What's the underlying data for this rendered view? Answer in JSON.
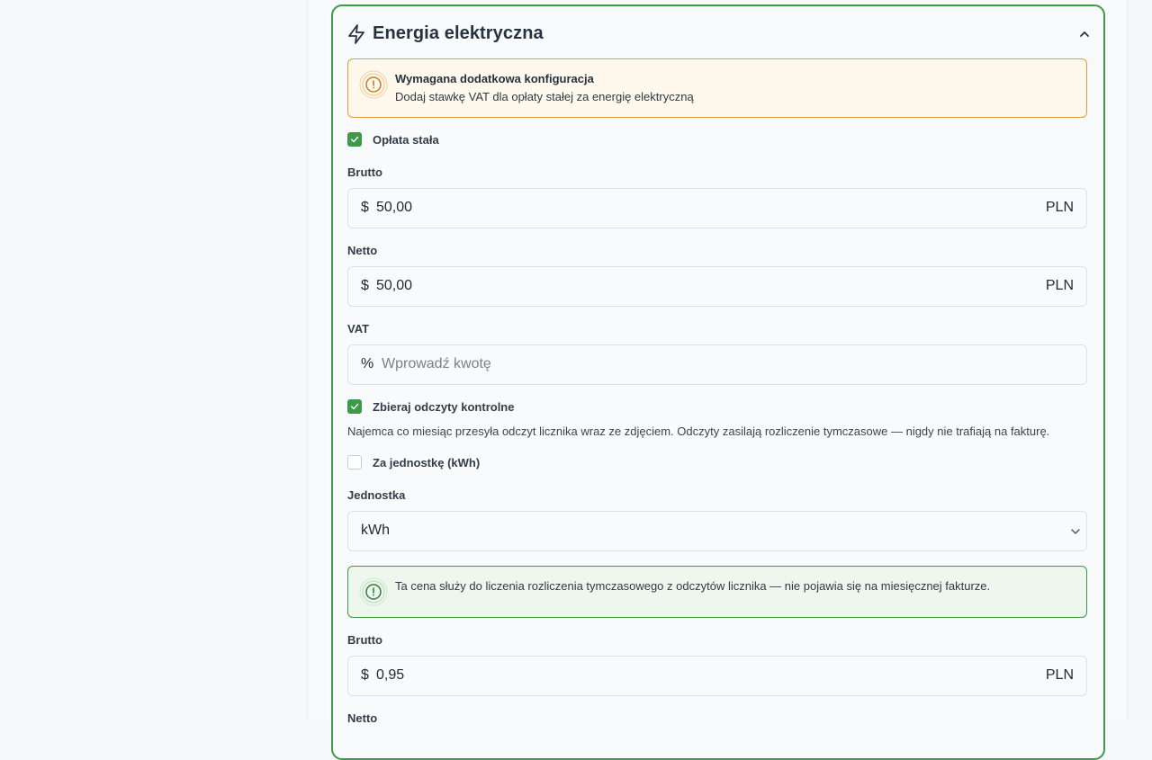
{
  "section": {
    "title": "Energia elektryczna",
    "icon": "bolt-icon",
    "collapse_icon": "chevron-up-icon"
  },
  "warning": {
    "title": "Wymagana dodatkowa konfiguracja",
    "text": "Dodaj stawkę VAT dla opłaty stałej za energię elektryczną",
    "icon": "alert-circle-icon"
  },
  "fixed_fee": {
    "checkbox_label": "Opłata stała",
    "checked": true,
    "gross": {
      "label": "Brutto",
      "prefix": "$",
      "value": "50,00",
      "suffix": "PLN"
    },
    "net": {
      "label": "Netto",
      "prefix": "$",
      "value": "50,00",
      "suffix": "PLN"
    },
    "vat": {
      "label": "VAT",
      "prefix": "%",
      "placeholder": "Wprowadź kwotę"
    }
  },
  "readings": {
    "checkbox_label": "Zbieraj odczyty kontrolne",
    "checked": true,
    "help": "Najemca co miesiąc przesyła odczyt licznika wraz ze zdjęciem. Odczyty zasilają rozliczenie tymczasowe — nigdy nie trafiają na fakturę."
  },
  "per_unit": {
    "checkbox_label": "Za jednostkę (kWh)",
    "checked": false,
    "unit": {
      "label": "Jednostka",
      "value": "kWh"
    },
    "info_text": "Ta cena służy do liczenia rozliczenia tymczasowego z odczytów licznika — nie pojawia się na miesięcznej fakturze.",
    "gross": {
      "label": "Brutto",
      "prefix": "$",
      "value": "0,95",
      "suffix": "PLN"
    },
    "net": {
      "label": "Netto"
    }
  },
  "colors": {
    "accent_green": "#3c9a48",
    "warning_orange": "#e69a3a",
    "warning_bg": "#fff8ec",
    "info_bg": "#eef7ee"
  }
}
